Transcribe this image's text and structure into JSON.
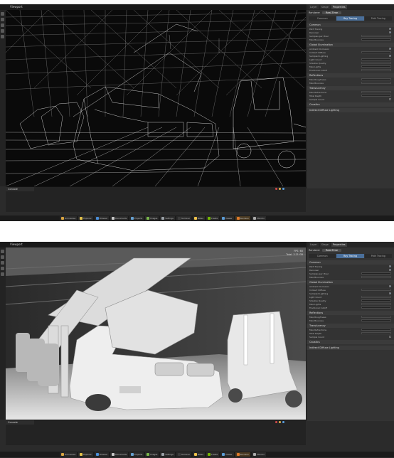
{
  "screens": [
    {
      "title": "Viewport",
      "renderer_label": "Renderer",
      "renderer_value": "Real-Time",
      "panel_tabs": [
        "Layer",
        "Stage",
        "Properties"
      ],
      "subtabs": [
        "Common",
        "Ray Tracing",
        "Path Tracing"
      ],
      "sections": [
        {
          "header": "Common",
          "rows": [
            "Path Tracing",
            "Denoiser",
            "Samples per Pixel",
            "Max Bounces"
          ]
        },
        {
          "header": "Global Illumination",
          "rows": [
            "Ambient Occlusion",
            "Indirect Diffuse",
            "Sampled Lighting",
            "Light Count",
            "Shadow Quality",
            "Max Lights",
            "Fractional Cutoff"
          ]
        },
        {
          "header": "Reflections",
          "rows": [
            "Max Roughness",
            "Max Bounces"
          ]
        },
        {
          "header": "Translucency",
          "rows": [
            "Max Refractions",
            "Total Depth",
            "Sample Count"
          ]
        },
        {
          "header": "Caustics",
          "rows": []
        },
        {
          "header": "Indirect Diffuse Lighting",
          "rows": []
        }
      ],
      "dock_label": "Console",
      "stats": []
    },
    {
      "title": "Viewport",
      "renderer_label": "Renderer",
      "renderer_value": "Real-Time",
      "panel_tabs": [
        "Layer",
        "Stage",
        "Properties"
      ],
      "subtabs": [
        "Common",
        "Ray Tracing",
        "Path Tracing"
      ],
      "sections": [
        {
          "header": "Common",
          "rows": [
            "Path Tracing",
            "Denoiser",
            "Samples per Pixel",
            "Max Bounces"
          ]
        },
        {
          "header": "Global Illumination",
          "rows": [
            "Ambient Occlusion",
            "Indirect Diffuse",
            "Sampled Lighting",
            "Light Count",
            "Shadow Quality",
            "Max Lights",
            "Fractional Cutoff"
          ]
        },
        {
          "header": "Reflections",
          "rows": [
            "Max Roughness",
            "Max Bounces"
          ]
        },
        {
          "header": "Translucency",
          "rows": [
            "Max Refractions",
            "Total Depth",
            "Sample Count"
          ]
        },
        {
          "header": "Caustics",
          "rows": []
        },
        {
          "header": "Indirect Diffuse Lighting",
          "rows": []
        }
      ],
      "dock_label": "Console",
      "stats": [
        "FPS: 60",
        "Total: 3.21 GB"
      ]
    }
  ],
  "taskbar": [
    {
      "label": "Omniverse",
      "color": "#d9a441"
    },
    {
      "label": "Explorer",
      "color": "#e2c14a"
    },
    {
      "label": "Browser",
      "color": "#4a8fd9"
    },
    {
      "label": "Documents",
      "color": "#c7c7c7"
    },
    {
      "label": "Projects",
      "color": "#66a0d0"
    },
    {
      "label": "Images",
      "color": "#7ab84c"
    },
    {
      "label": "Settings",
      "color": "#9aa0a6"
    },
    {
      "label": "Terminal",
      "color": "#3c3c3c"
    },
    {
      "label": "Notes",
      "color": "#f0c24a"
    },
    {
      "label": "Create",
      "color": "#76b900"
    },
    {
      "label": "Viewer",
      "color": "#5b9bd5"
    },
    {
      "label": "Renderer",
      "color": "#e07a2a"
    },
    {
      "label": "Monitor",
      "color": "#aaaaaa"
    }
  ]
}
